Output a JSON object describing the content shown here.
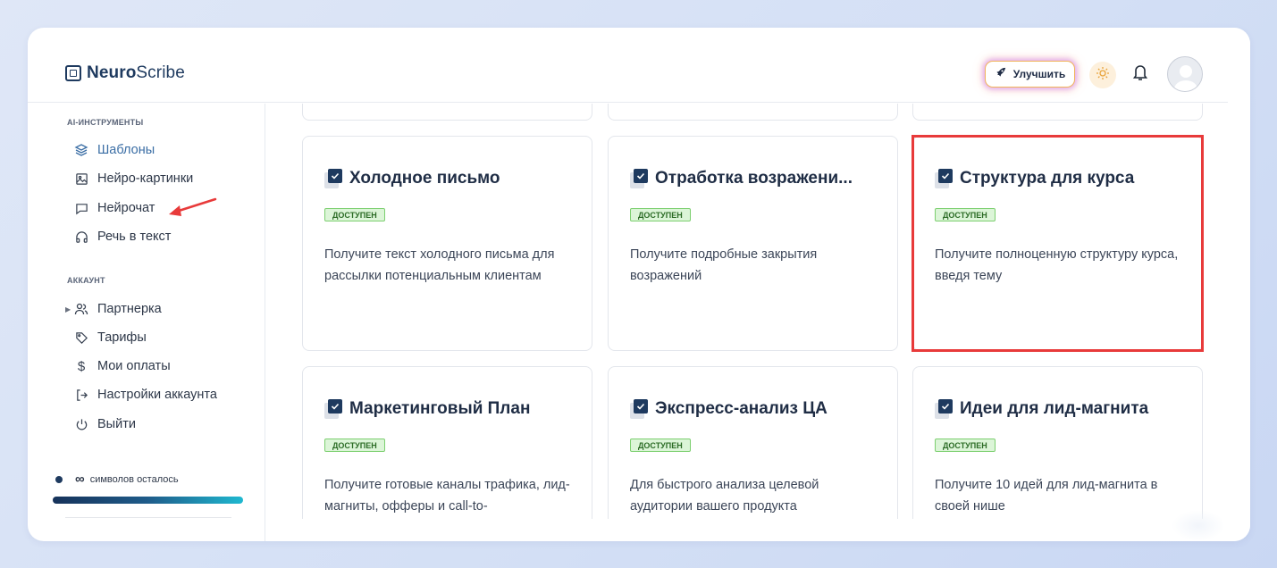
{
  "app": {
    "logo_bold": "Neuro",
    "logo_light": "Scribe"
  },
  "header": {
    "upgrade_label": "Улучшить"
  },
  "sidebar": {
    "section_tools": "AI-ИНСТРУМЕНТЫ",
    "tools": [
      {
        "label": "Шаблоны",
        "icon": "layers-icon",
        "active": true
      },
      {
        "label": "Нейро-картинки",
        "icon": "image-icon"
      },
      {
        "label": "Нейрочат",
        "icon": "chat-icon"
      },
      {
        "label": "Речь в текст",
        "icon": "headphones-icon"
      }
    ],
    "section_account": "АККАУНТ",
    "account": [
      {
        "label": "Партнерка",
        "icon": "users-icon"
      },
      {
        "label": "Тарифы",
        "icon": "tag-icon"
      },
      {
        "label": "Мои оплаты",
        "icon": "dollar-icon"
      },
      {
        "label": "Настройки аккаунта",
        "icon": "login-icon"
      },
      {
        "label": "Выйти",
        "icon": "power-icon"
      }
    ],
    "credits_symbol": "∞",
    "credits_label": "символов осталось"
  },
  "templates": [
    {
      "title": "Холодное письмо",
      "badge": "ДОСТУПЕН",
      "desc": "Получите текст холодного письма для рассылки потенциальным клиентам"
    },
    {
      "title": "Отработка возражени...",
      "badge": "ДОСТУПЕН",
      "desc": "Получите подробные закрытия возражений"
    },
    {
      "title": "Структура для курса",
      "badge": "ДОСТУПЕН",
      "desc": "Получите полноценную структуру курса, введя тему"
    },
    {
      "title": "Маркетинговый План",
      "badge": "ДОСТУПЕН",
      "desc": "Получите готовые каналы трафика, лид-магниты, офферы и call-to-"
    },
    {
      "title": "Экспресс-анализ ЦА",
      "badge": "ДОСТУПЕН",
      "desc": "Для быстрого анализа целевой аудитории вашего продукта"
    },
    {
      "title": "Идеи для лид-магнита",
      "badge": "ДОСТУПЕН",
      "desc": "Получите 10 идей для лид-магнита в своей нише"
    }
  ],
  "colors": {
    "accent": "#3b6ea5",
    "brand": "#1e3a5f",
    "highlight": "#e83a3a",
    "badge_bg": "#dcf5d8"
  }
}
